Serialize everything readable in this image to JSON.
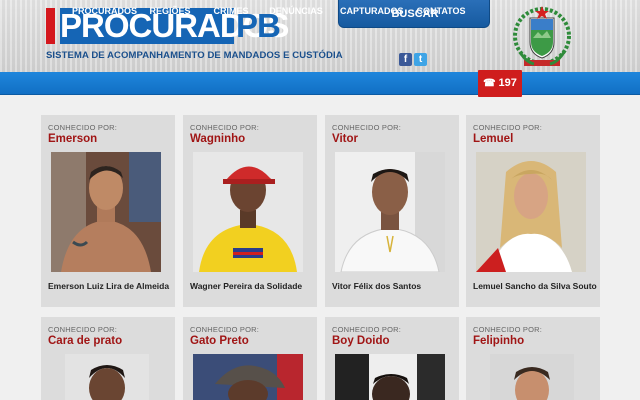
{
  "header": {
    "logo_main": "PROCURADOS",
    "logo_suffix": "PB",
    "logo_subtitle": "SISTEMA DE ACOMPANHAMENTO DE MANDADOS E CUSTÓDIA",
    "search_label": "BUSCAR",
    "facebook_icon": "f",
    "twitter_icon": "t"
  },
  "nav": {
    "items": [
      {
        "label": "PROCURADOS"
      },
      {
        "label": "REGIÕES"
      },
      {
        "label": "CRIMES"
      },
      {
        "label": "DENÚNCIAS"
      },
      {
        "label": "CAPTURADOS"
      },
      {
        "label": "CONTATOS"
      }
    ],
    "phone": "197",
    "phone_icon": "☎"
  },
  "cards": [
    {
      "label": "CONHECIDO POR:",
      "nickname": "Emerson",
      "full_name": "Emerson Luiz Lira de Almeida"
    },
    {
      "label": "CONHECIDO POR:",
      "nickname": "Wagninho",
      "full_name": "Wagner Pereira da Solidade"
    },
    {
      "label": "CONHECIDO POR:",
      "nickname": "Vitor",
      "full_name": "Vitor Félix dos Santos"
    },
    {
      "label": "CONHECIDO POR:",
      "nickname": "Lemuel",
      "full_name": "Lemuel Sancho da Silva Souto"
    },
    {
      "label": "CONHECIDO POR:",
      "nickname": "Cara de prato",
      "full_name": ""
    },
    {
      "label": "CONHECIDO POR:",
      "nickname": "Gato Preto",
      "full_name": ""
    },
    {
      "label": "CONHECIDO POR:",
      "nickname": "Boy Doido",
      "full_name": ""
    },
    {
      "label": "CONHECIDO POR:",
      "nickname": "Felipinho",
      "full_name": ""
    }
  ],
  "colors": {
    "brand_blue": "#1565b5",
    "nav_blue": "#1a7fd6",
    "accent_red": "#cf1d1d",
    "nickname_red": "#a01515"
  }
}
